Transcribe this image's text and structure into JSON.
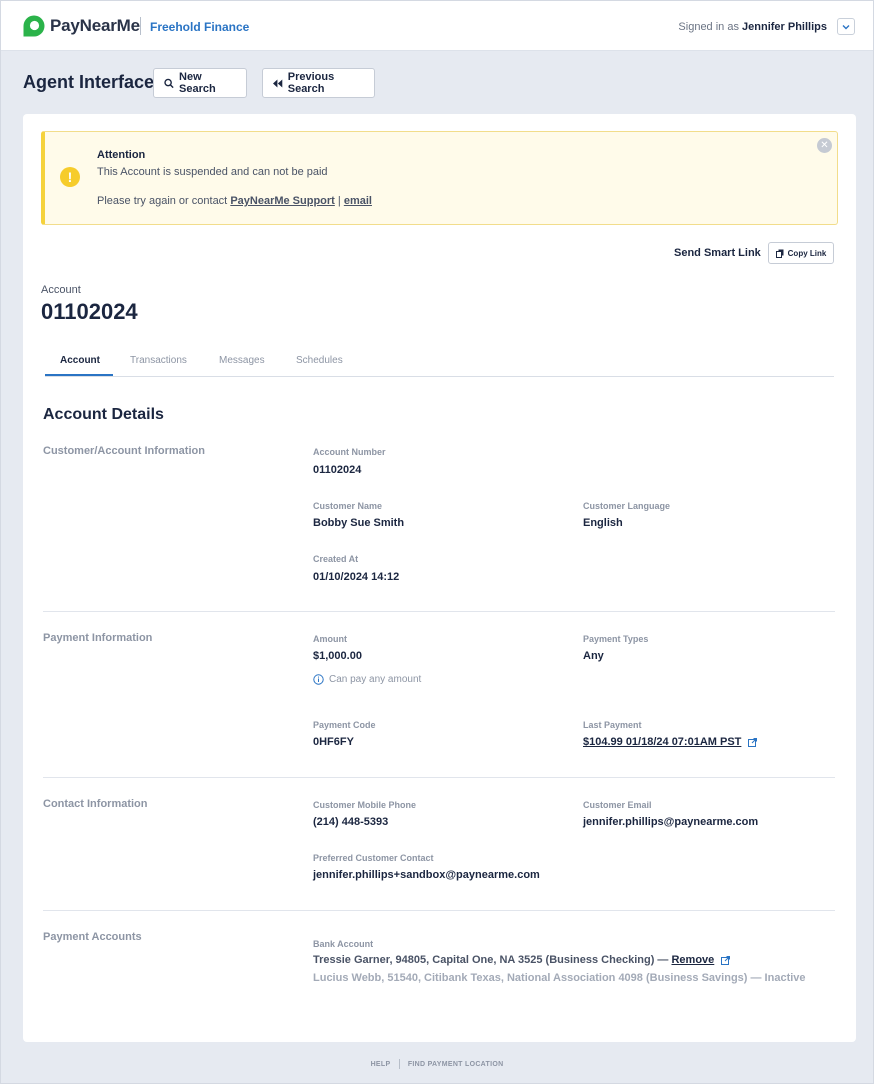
{
  "header": {
    "brand": "PayNearMe",
    "org": "Freehold Finance",
    "signed_in_prefix": "Signed in as",
    "user_name": "Jennifer Phillips",
    "user_menu_icon": "chevron-down-icon"
  },
  "toolbar": {
    "page_title": "Agent Interface",
    "new_search_label": "New Search",
    "previous_search_label": "Previous Search"
  },
  "alert": {
    "title": "Attention",
    "message": "This Account is suspended and can not be paid",
    "contact_prefix": "Please try again or contact",
    "support_link": "PayNearMe Support",
    "separator": "|",
    "email_link": "email",
    "color": "#f5d23c"
  },
  "smart_link": {
    "label": "Send Smart Link",
    "copy_label": "Copy Link"
  },
  "account": {
    "label": "Account",
    "number": "01102024"
  },
  "tabs": [
    {
      "label": "Account",
      "active": true
    },
    {
      "label": "Transactions",
      "active": false
    },
    {
      "label": "Messages",
      "active": false
    },
    {
      "label": "Schedules",
      "active": false
    }
  ],
  "details": {
    "title": "Account Details",
    "customer": {
      "heading": "Customer/Account Information",
      "account_number_label": "Account Number",
      "account_number": "01102024",
      "customer_name_label": "Customer Name",
      "customer_name": "Bobby Sue Smith",
      "language_label": "Customer Language",
      "language": "English",
      "created_label": "Created At",
      "created": "01/10/2024 14:12"
    },
    "payment": {
      "heading": "Payment Information",
      "amount_label": "Amount",
      "amount": "$1,000.00",
      "amount_hint": "Can pay any amount",
      "types_label": "Payment Types",
      "types": "Any",
      "code_label": "Payment Code",
      "code": "0HF6FY",
      "last_label": "Last Payment",
      "last": "$104.99 01/18/24 07:01AM PST"
    },
    "contact": {
      "heading": "Contact Information",
      "phone_label": "Customer Mobile Phone",
      "phone": "(214) 448-5393",
      "email_label": "Customer Email",
      "email": "jennifer.phillips@paynearme.com",
      "preferred_label": "Preferred Customer Contact",
      "preferred": "jennifer.phillips+sandbox@paynearme.com"
    },
    "accounts": {
      "heading": "Payment Accounts",
      "bank_label": "Bank Account",
      "bank_active": "Tressie Garner, 94805, Capital One, NA 3525 (Business Checking) —",
      "remove_label": "Remove",
      "bank_inactive": "Lucius Webb, 51540, Citibank Texas, National Association 4098 (Business Savings) — Inactive"
    }
  },
  "footer": {
    "help": "HELP",
    "find": "FIND PAYMENT LOCATION"
  },
  "colors": {
    "accent": "#2a74c4",
    "brand_green": "#2bb34a",
    "background": "#e6eaf1"
  }
}
